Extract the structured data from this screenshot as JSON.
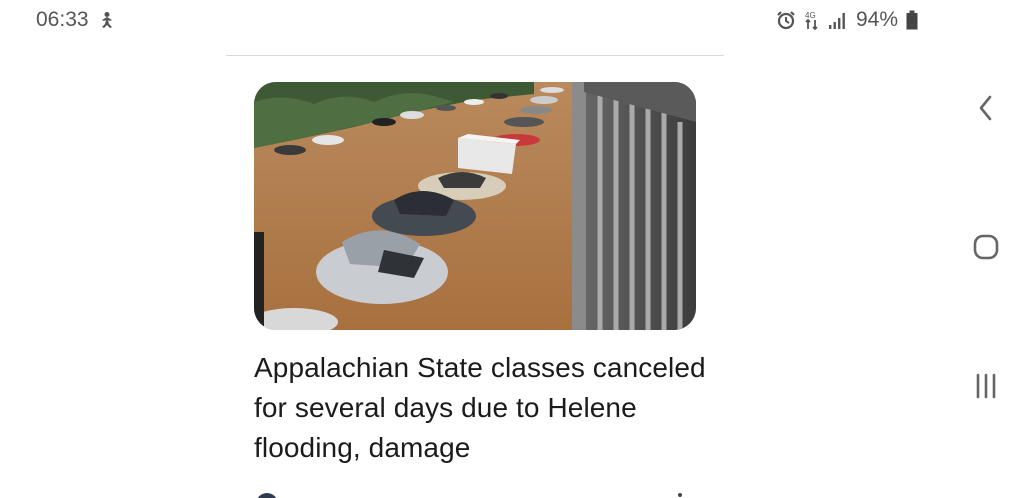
{
  "status_bar": {
    "time": "06:33",
    "battery_percent": "94%",
    "icons": [
      "notification-person-icon",
      "alarm-icon",
      "data-arrows-icon",
      "signal-icon",
      "battery-icon"
    ]
  },
  "article": {
    "image_alt_icon": "flood-photo",
    "headline": "Appalachian State classes canceled for several days due to Helene flooding, damage"
  },
  "nav_bar": {
    "buttons": [
      "back-icon",
      "home-icon",
      "recent-apps-icon"
    ]
  },
  "colors": {
    "status_text": "#555555",
    "headline_text": "#1b1b1b",
    "divider": "#d9d9d9",
    "flood_water": "#b07a4c"
  }
}
